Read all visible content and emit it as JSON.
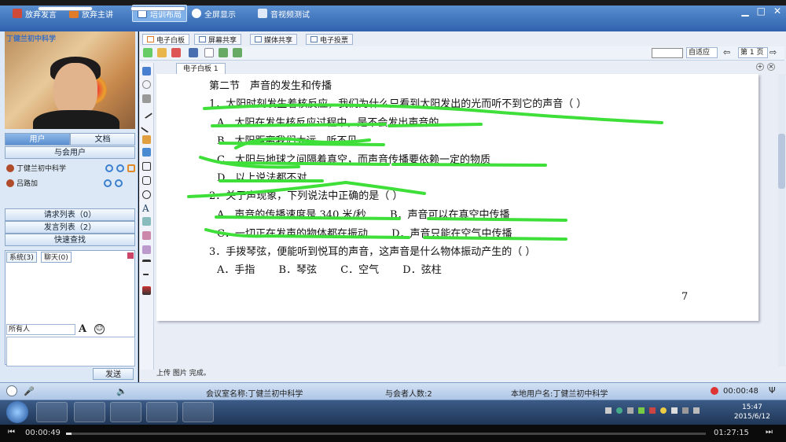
{
  "toolbar": {
    "give_up_speak": "放弃发言",
    "give_up_host": "放弃主讲",
    "layout": "培训布局",
    "fullscreen": "全屏显示",
    "av_test": "音视频测试"
  },
  "left": {
    "camera_name": "丁健兰初中科学",
    "tabs": [
      "用户",
      "文档"
    ],
    "attendees": "与会用户",
    "users": [
      {
        "name": "丁健兰初中科学"
      },
      {
        "name": "吕路加"
      }
    ],
    "request_list": "请求列表（0）",
    "speak_list": "发言列表（2）",
    "quick_search": "快速查找",
    "chat_tabs": [
      "系统(3)",
      "聊天(0)"
    ],
    "recipient": "所有人",
    "send": "发送"
  },
  "main": {
    "tabs": [
      "电子白板",
      "屏幕共享",
      "媒体共享",
      "电子投票"
    ],
    "zoom": "自适应",
    "page": "第 1 页",
    "wb_tab": "电子白板 1",
    "status": "上传 图片 完成。"
  },
  "doc": {
    "heading": "第二节　声音的发生和传播",
    "q1": "1．太阳时刻发生着核反应，我们为什么只看到太阳发出的光而听不到它的声音（ ）",
    "q1a": "A．太阳在发生核反应过程中，是不会发出声音的",
    "q1b": "B．太阳距离我们太远，听不见",
    "q1c": "C．太阳与地球之间隔着真空，而声音传播要依赖一定的物质",
    "q1d": "D．以上说法都不对",
    "q2": "2．关于声现象，下列说法中正确的是（ ）",
    "q2ab": "A．声音的传播速度是 340 米/秒　　 B．声音可以在真空中传播",
    "q2cd": "C．一切正在发声的物体都在振动　　 D．声音只能在空气中传播",
    "q3": "3．手拨琴弦，便能听到悦耳的声音，这声音是什么物体振动产生的（ ）",
    "q3opts": "A．手指　　 B．琴弦　　 C．空气　　 D．弦柱",
    "page_num": "7"
  },
  "info": {
    "room": "会议室名称:丁健兰初中科学",
    "count": "与会者人数:2",
    "local_user": "本地用户名:丁健兰初中科学",
    "timer": "00:00:48"
  },
  "taskbar": {
    "time": "15:47",
    "date": "2015/6/12"
  },
  "player": {
    "elapsed": "00:00:49",
    "total": "01:27:15",
    "progress": 0.009
  }
}
